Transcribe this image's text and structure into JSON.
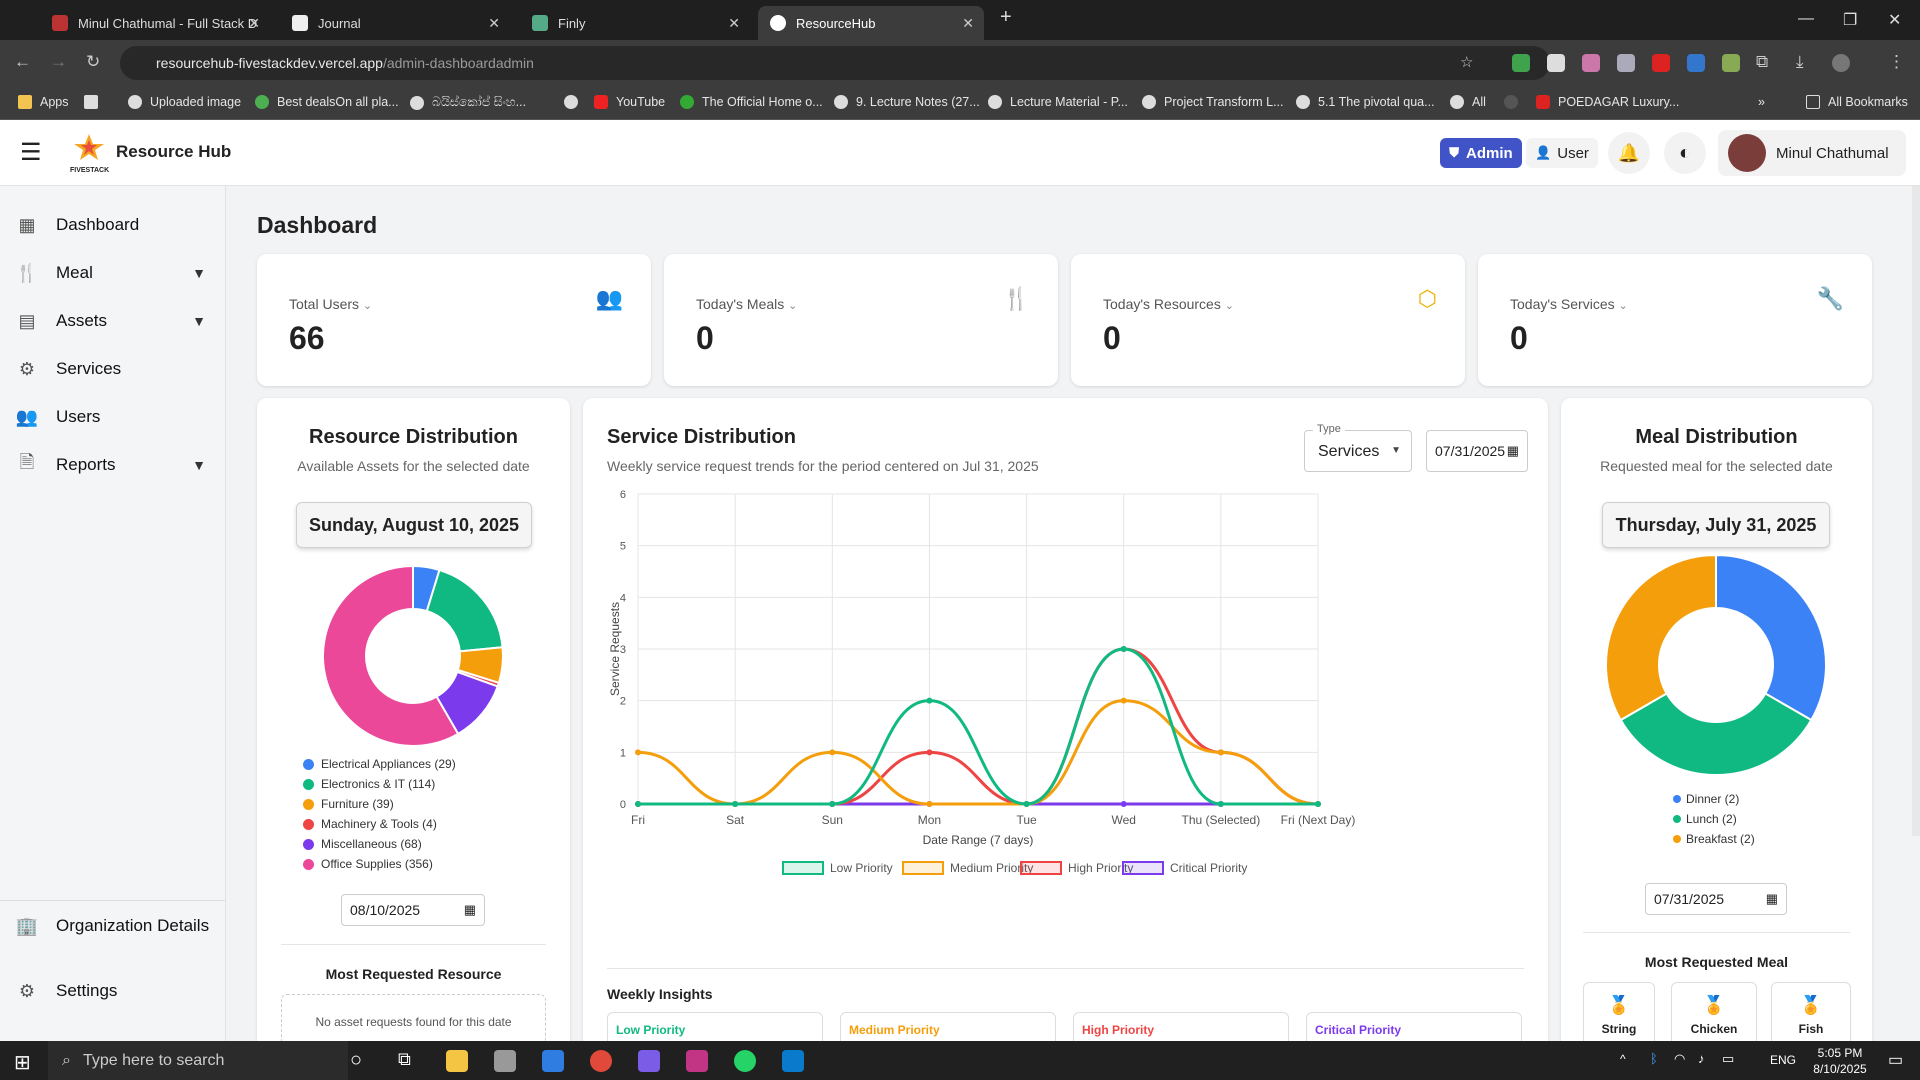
{
  "browser": {
    "tabs": [
      {
        "title": "Minul Chathumal - Full Stack D"
      },
      {
        "title": "Journal"
      },
      {
        "title": "Finly"
      },
      {
        "title": "ResourceHub"
      }
    ],
    "url_host": "resourcehub-fivestackdev.vercel.app",
    "url_path": "/admin-dashboardadmin",
    "bookmarks": [
      "Apps",
      "Uploaded image",
      "Best dealsOn all pla...",
      "බයිස්කෝප් සිංහ...",
      "",
      "YouTube",
      "The Official Home o...",
      "9. Lecture Notes (27...",
      "Lecture Material - P...",
      "Project Transform L...",
      "5.1 The pivotal qua...",
      "All",
      "",
      "POEDAGAR Luxury..."
    ],
    "all_bookmarks": "All Bookmarks"
  },
  "app": {
    "title": "Resource Hub",
    "logo_text": "FIVESTACK",
    "admin_label": "Admin",
    "user_label": "User",
    "profile_name": "Minul Chathumal"
  },
  "sidebar": {
    "items": [
      {
        "label": "Dashboard"
      },
      {
        "label": "Meal"
      },
      {
        "label": "Assets"
      },
      {
        "label": "Services"
      },
      {
        "label": "Users"
      },
      {
        "label": "Reports"
      }
    ],
    "org_details": "Organization Details",
    "settings": "Settings"
  },
  "page": {
    "title": "Dashboard"
  },
  "stats": [
    {
      "label": "Total Users",
      "value": "66",
      "color": "#3b82f6"
    },
    {
      "label": "Today's Meals",
      "value": "0",
      "color": "#10b981"
    },
    {
      "label": "Today's Resources",
      "value": "0",
      "color": "#eab308"
    },
    {
      "label": "Today's Services",
      "value": "0",
      "color": "#ef4444"
    }
  ],
  "resource": {
    "title": "Resource Distribution",
    "subtitle": "Available Assets for the selected date",
    "date_label": "Sunday, August 10, 2025",
    "date_input": "08/10/2025",
    "most_title": "Most Requested Resource",
    "empty_text": "No asset requests found for this date",
    "legend": [
      {
        "label": "Electrical Appliances (29)",
        "value": 29,
        "color": "#3b82f6"
      },
      {
        "label": "Electronics & IT (114)",
        "value": 114,
        "color": "#10b981"
      },
      {
        "label": "Furniture (39)",
        "value": 39,
        "color": "#f59e0b"
      },
      {
        "label": "Machinery & Tools (4)",
        "value": 4,
        "color": "#ef4444"
      },
      {
        "label": "Miscellaneous (68)",
        "value": 68,
        "color": "#7c3aed"
      },
      {
        "label": "Office Supplies (356)",
        "value": 356,
        "color": "#ec4899"
      }
    ]
  },
  "service": {
    "title": "Service Distribution",
    "subtitle": "Weekly service request trends for the period centered on Jul 31, 2025",
    "type_label": "Type",
    "type_value": "Services",
    "date_input": "07/31/2025",
    "insights_title": "Weekly Insights",
    "insights": [
      "Low Priority",
      "Medium Priority",
      "High Priority",
      "Critical Priority"
    ]
  },
  "meal": {
    "title": "Meal Distribution",
    "subtitle": "Requested meal for the selected date",
    "date_label": "Thursday, July 31, 2025",
    "date_input": "07/31/2025",
    "most_title": "Most Requested Meal",
    "legend": [
      {
        "label": "Dinner (2)",
        "value": 2,
        "color": "#3b82f6"
      },
      {
        "label": "Lunch (2)",
        "value": 2,
        "color": "#10b981"
      },
      {
        "label": "Breakfast (2)",
        "value": 2,
        "color": "#f59e0b"
      }
    ],
    "top_meals": [
      "String",
      "Chicken",
      "Fish"
    ]
  },
  "chart_data": [
    {
      "type": "pie",
      "title": "Resource Distribution",
      "categories": [
        "Electrical Appliances",
        "Electronics & IT",
        "Furniture",
        "Machinery & Tools",
        "Miscellaneous",
        "Office Supplies"
      ],
      "values": [
        29,
        114,
        39,
        4,
        68,
        356
      ]
    },
    {
      "type": "line",
      "title": "Service Distribution",
      "xlabel": "Date Range (7 days)",
      "ylabel": "Service Requests",
      "ylim": [
        0,
        6
      ],
      "yticks": [
        "0",
        "1",
        "2",
        "3",
        "4",
        "5",
        "6"
      ],
      "categories": [
        "Fri",
        "Sat",
        "Sun",
        "Mon",
        "Tue",
        "Wed",
        "Thu (Selected)",
        "Fri (Next Day)"
      ],
      "series": [
        {
          "name": "Low Priority",
          "color": "#10b981",
          "values": [
            0,
            0,
            0,
            2,
            0,
            3,
            0,
            0
          ]
        },
        {
          "name": "Medium Priority",
          "color": "#f59e0b",
          "values": [
            1,
            0,
            1,
            0,
            0,
            2,
            1,
            0
          ]
        },
        {
          "name": "High Priority",
          "color": "#ef4444",
          "values": [
            0,
            0,
            0,
            1,
            0,
            3,
            1,
            0
          ]
        },
        {
          "name": "Critical Priority",
          "color": "#7c3aed",
          "values": [
            0,
            0,
            0,
            0,
            0,
            0,
            0,
            0
          ]
        }
      ],
      "grid": true,
      "legend": "bottom"
    },
    {
      "type": "pie",
      "title": "Meal Distribution",
      "categories": [
        "Dinner",
        "Lunch",
        "Breakfast"
      ],
      "values": [
        2,
        2,
        2
      ]
    }
  ],
  "taskbar": {
    "search_placeholder": "Type here to search",
    "time": "5:05 PM",
    "date": "8/10/2025",
    "lang": "ENG"
  }
}
